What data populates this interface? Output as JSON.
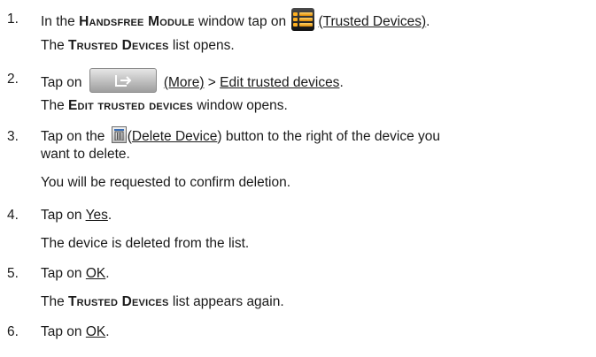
{
  "steps": [
    {
      "number": "1.",
      "action": {
        "prefix": "In the ",
        "window": "Handsfree Module",
        "middle": " window tap on ",
        "icon": "trusted-devices-icon",
        "label": "(Trusted Devices)",
        "suffix": "."
      },
      "result": {
        "prefix": "The ",
        "name": "Trusted Devices",
        "suffix": " list opens."
      }
    },
    {
      "number": "2.",
      "action": {
        "prefix": "Tap on ",
        "icon": "more-button",
        "label": "(More)",
        "separator": " > ",
        "item": "Edit trusted devices",
        "suffix": "."
      },
      "result": {
        "prefix": "The ",
        "name": "Edit trusted devices",
        "suffix": " window opens."
      }
    },
    {
      "number": "3.",
      "action": {
        "prefix": "Tap on the ",
        "icon": "delete-icon",
        "label_open": "(",
        "label_link": "Delete Device",
        "label_close": ")",
        "line1_rest": " button to the right of the device you",
        "line2": "want to delete."
      },
      "result": {
        "text": "You will be requested to confirm deletion."
      }
    },
    {
      "number": "4.",
      "action": {
        "prefix": "Tap on ",
        "link": "Yes",
        "suffix": "."
      },
      "result": {
        "text": "The device is deleted from the list."
      }
    },
    {
      "number": "5.",
      "action": {
        "prefix": "Tap on ",
        "link": "OK",
        "suffix": "."
      },
      "result": {
        "prefix": "The ",
        "name": "Trusted Devices",
        "suffix": " list appears again."
      }
    },
    {
      "number": "6.",
      "action": {
        "prefix": "Tap on ",
        "link": "OK",
        "suffix": "."
      }
    }
  ]
}
